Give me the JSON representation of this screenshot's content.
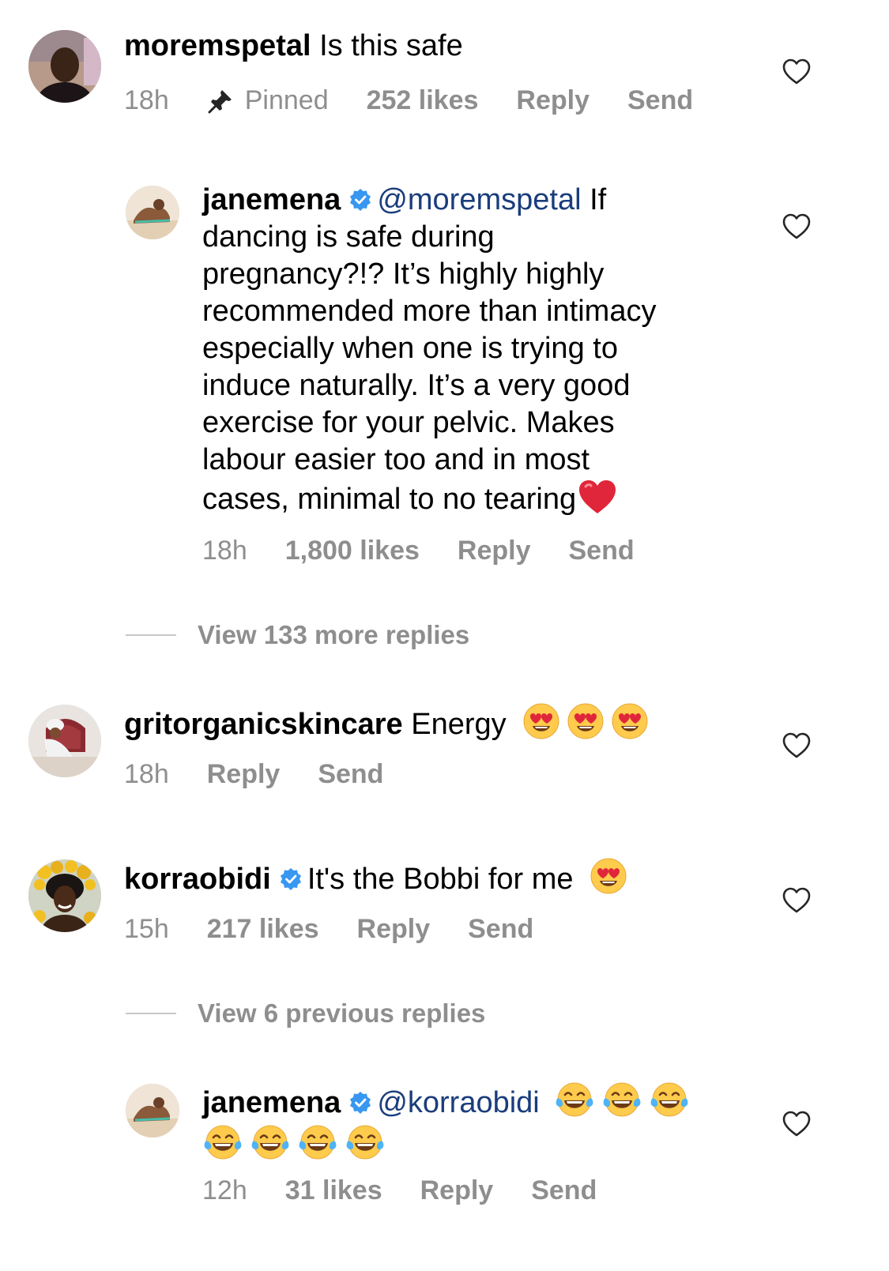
{
  "comments": [
    {
      "username": "moremspetal",
      "text": "Is this safe",
      "time": "18h",
      "pinned_label": "Pinned",
      "likes": "252 likes",
      "reply_label": "Reply",
      "send_label": "Send"
    },
    {
      "username": "janemena",
      "mention": "@moremspetal",
      "text_lines": [
        "If",
        "dancing is safe during",
        "pregnancy?!? It’s highly highly",
        "recommended more than intimacy",
        "especially when one is trying to",
        "induce naturally. It’s a very good",
        "exercise for your pelvic. Makes",
        "labour easier too  and in most",
        "cases, minimal to no tearing"
      ],
      "time": "18h",
      "likes": "1,800 likes",
      "reply_label": "Reply",
      "send_label": "Send"
    },
    {
      "username": "gritorganicskincare",
      "text": "Energy",
      "time": "18h",
      "reply_label": "Reply",
      "send_label": "Send"
    },
    {
      "username": "korraobidi",
      "text": "It's the Bobbi for me",
      "time": "15h",
      "likes": "217 likes",
      "reply_label": "Reply",
      "send_label": "Send"
    },
    {
      "username": "janemena",
      "mention": "@korraobidi",
      "time": "12h",
      "likes": "31 likes",
      "reply_label": "Reply",
      "send_label": "Send"
    }
  ],
  "view_more_1": "View 133 more replies",
  "view_more_2": "View 6 previous replies",
  "icons": {
    "like": "heart-outline-icon",
    "verified": "verified-badge-icon",
    "pin": "pin-icon",
    "emoji_heart_eyes": "heart-eyes-emoji",
    "emoji_laughing": "tears-of-joy-emoji",
    "emoji_red_heart": "red-heart-emoji"
  },
  "colors": {
    "meta_gray": "#8e8e8e",
    "mention_blue": "#1a3d7c",
    "verified_blue": "#3897f0"
  }
}
